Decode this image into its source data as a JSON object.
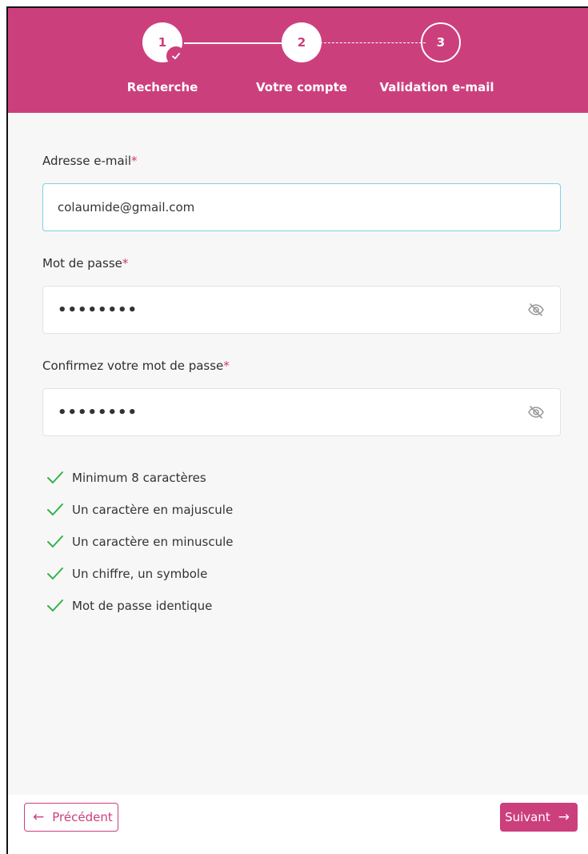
{
  "stepper": {
    "steps": [
      {
        "number": "1",
        "label": "Recherche",
        "state": "completed"
      },
      {
        "number": "2",
        "label": "Votre compte",
        "state": "active"
      },
      {
        "number": "3",
        "label": "Validation e-mail",
        "state": "pending"
      }
    ]
  },
  "form": {
    "email": {
      "label": "Adresse e-mail",
      "required_mark": "*",
      "value": "colaumide@gmail.com"
    },
    "password": {
      "label": "Mot de passe",
      "required_mark": "*",
      "value": "••••••••",
      "toggle_icon": "eye-off-icon"
    },
    "confirm": {
      "label": "Confirmez votre mot de passe",
      "required_mark": "*",
      "value": "••••••••",
      "toggle_icon": "eye-off-icon"
    }
  },
  "rules": [
    {
      "text": "Minimum 8 caractères",
      "met": true
    },
    {
      "text": "Un caractère en majuscule",
      "met": true
    },
    {
      "text": "Un caractère en minuscule",
      "met": true
    },
    {
      "text": "Un chiffre, un symbole",
      "met": true
    },
    {
      "text": "Mot de passe identique",
      "met": true
    }
  ],
  "footer": {
    "prev_label": "Précédent",
    "next_label": "Suivant"
  },
  "colors": {
    "brand": "#cc3f7d",
    "check": "#34b34a",
    "focus_border": "#7fd0e3"
  }
}
